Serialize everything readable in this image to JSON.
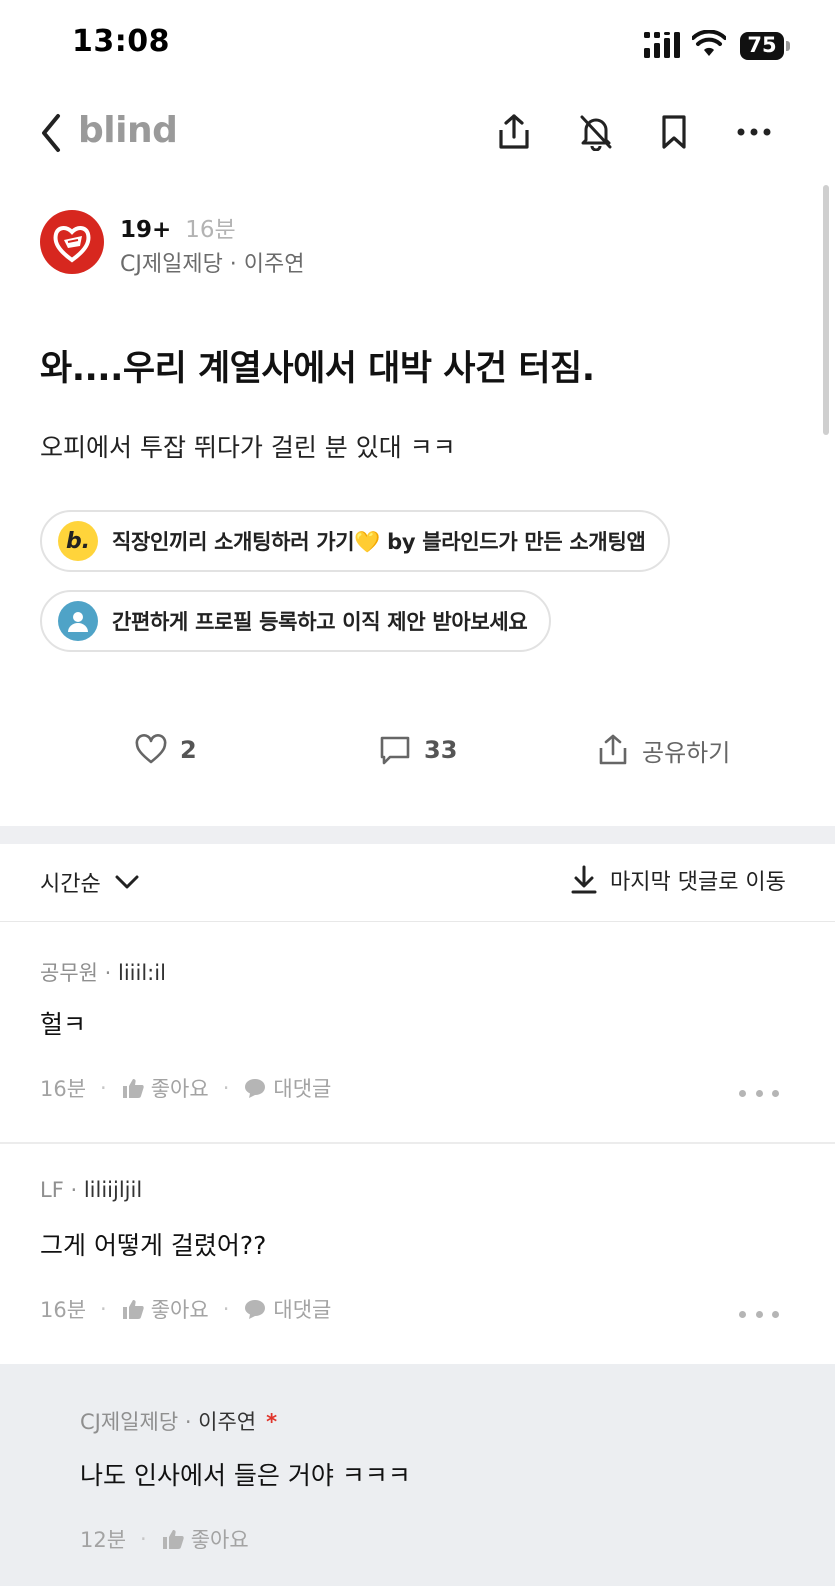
{
  "status": {
    "time": "13:08",
    "battery": "75"
  },
  "nav": {
    "brand": "blind",
    "icons": [
      "back-icon",
      "share-icon",
      "bell-off-icon",
      "bookmark-icon",
      "more-icon"
    ]
  },
  "post": {
    "author_nickname": "19+",
    "time": "16분",
    "company_line": "CJ제일제당 · 이주연",
    "title": "와....우리 계열사에서 대박 사건 터짐.",
    "body": "오피에서 투잡 뛰다가 걸린 분 있대 ㅋㅋ"
  },
  "promos": [
    {
      "icon": "b",
      "text": "직장인끼리 소개팅하러 가기💛 by 블라인드가 만든 소개팅앱"
    },
    {
      "icon": "person",
      "text": "간편하게 프로필 등록하고 이직 제안 받아보세요"
    }
  ],
  "actions": {
    "likes": "2",
    "comments": "33",
    "share_label": "공유하기"
  },
  "sort": {
    "selected": "시간순",
    "jump_label": "마지막 댓글로 이동"
  },
  "comments": [
    {
      "company": "공무원",
      "nickname": "liiil:il",
      "text": "헐ㅋ",
      "time": "16분",
      "like_label": "좋아요",
      "reply_label": "대댓글"
    },
    {
      "company": "LF",
      "nickname": "liliijljil",
      "text": "그게 어떻게 걸렸어??",
      "time": "16분",
      "like_label": "좋아요",
      "reply_label": "대댓글"
    },
    {
      "company": "CJ제일제당",
      "nickname": "이주연",
      "op_mark": "*",
      "text": "나도 인사에서 들은 거야 ㅋㅋㅋ",
      "time": "12분",
      "like_label": "좋아요"
    }
  ],
  "colors": {
    "accent_red": "#e0342b",
    "avatar_bg": "#d7271f",
    "divider": "#eeeff2",
    "reply_bg": "#eceef1"
  }
}
